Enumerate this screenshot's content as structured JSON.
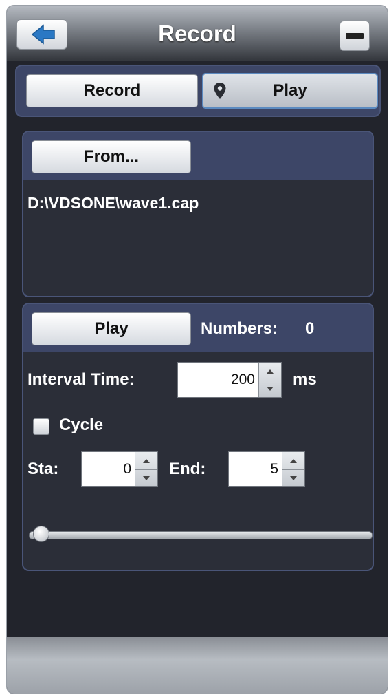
{
  "header": {
    "title": "Record"
  },
  "mode_tabs": {
    "record_label": "Record",
    "play_label": "Play",
    "active": "Play"
  },
  "file_section": {
    "from_label": "From...",
    "file_path": "D:\\VDSONE\\wave1.cap"
  },
  "playback": {
    "play_label": "Play",
    "numbers_label": "Numbers:",
    "numbers_value": "0",
    "interval_label": "Interval Time:",
    "interval_value": "200",
    "interval_unit": "ms",
    "cycle_label": "Cycle",
    "cycle_checked": false,
    "start_label": "Sta:",
    "start_value": "0",
    "end_label": "End:",
    "end_value": "5",
    "slider_position": 0
  },
  "colors": {
    "panel_header": "#3d4667",
    "panel_border": "#4a5578",
    "window_bg": "#22242c",
    "active_tab_border": "#5b8ac0"
  },
  "icons": {
    "back": "left-arrow-icon",
    "minimize": "minus-icon",
    "location": "map-pin-icon"
  }
}
